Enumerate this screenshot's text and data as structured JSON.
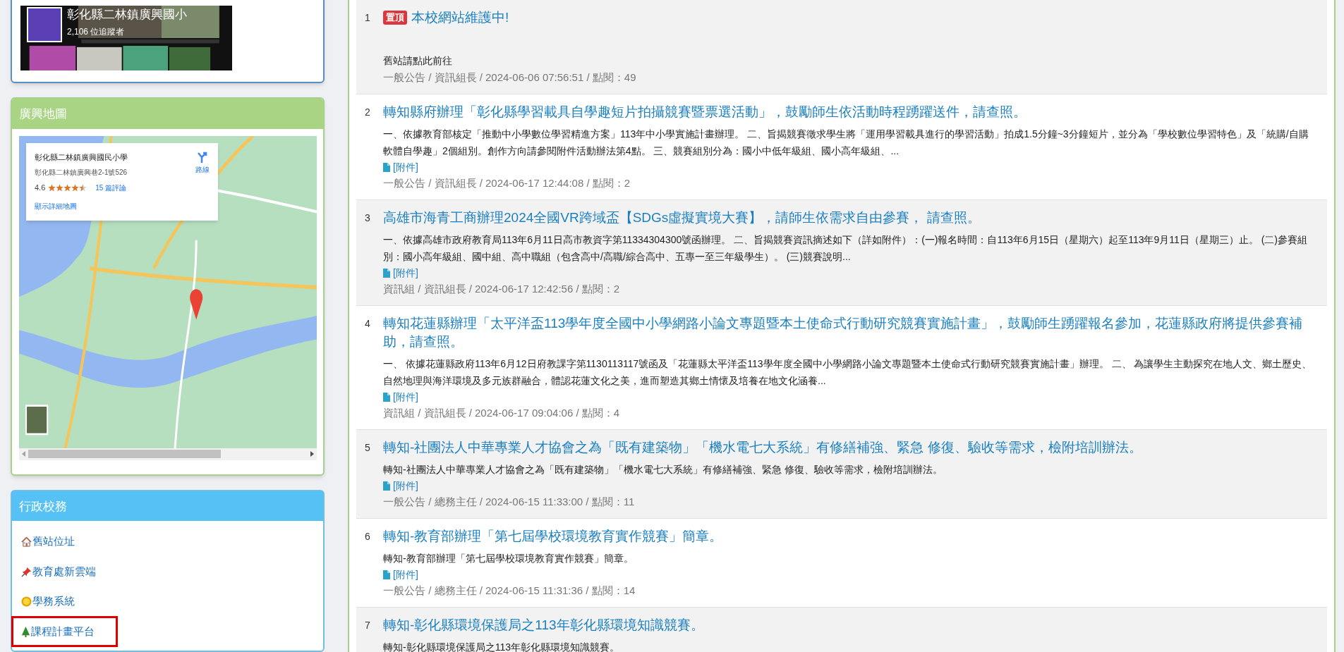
{
  "facebook_widget": {
    "page_name": "彰化縣二林鎮廣興國小",
    "followers": "2,106 位追蹤者"
  },
  "map_card": {
    "title": "廣興地圖",
    "place_name": "彰化縣二林鎮廣興國民小學",
    "address": "彰化縣二林鎮廣興巷2-1號526",
    "rating": "4.6",
    "stars": 4.5,
    "reviews": "15 篇評論",
    "directions": "路線",
    "larger_map": "顯示詳細地圖"
  },
  "admin_card": {
    "title": "行政校務",
    "items": [
      {
        "label": "舊站位址",
        "kind": "house",
        "highlighted": false
      },
      {
        "label": "教育處新雲端",
        "kind": "pin",
        "highlighted": false
      },
      {
        "label": "學務系統",
        "kind": "sun",
        "highlighted": false
      },
      {
        "label": "課程計畫平台",
        "kind": "tree",
        "highlighted": true
      }
    ]
  },
  "news": [
    {
      "number": "1",
      "badge": "置頂",
      "title": "本校網站維護中!",
      "summary": "舊站請點此前往",
      "meta": "一般公告 / 資訊組長 / 2024-06-06 07:56:51 / 點閱：49"
    },
    {
      "number": "2",
      "title": "轉知縣府辦理「彰化縣學習載具自學趣短片拍攝競賽暨票選活動」，鼓勵師生依活動時程踴躍送件，請查照。",
      "summary": "一、依據教育部核定「推動中小學數位學習精進方案」113年中小學實施計畫辦理。 二、旨揭競賽徵求學生將「運用學習載具進行的學習活動」拍成1.5分鐘~3分鐘短片，並分為「學校數位學習特色」及「統購/自購軟體自學趣」2個組別。創作方向請參閱附件活動辦法第4點。 三、競賽組別分為：國小中低年級組、國小高年級組、...",
      "attachment": "[附件]",
      "meta": "一般公告 / 資訊組長 / 2024-06-17 12:44:08 / 點閱：2"
    },
    {
      "number": "3",
      "title": "高雄市海青工商辦理2024全國VR跨域盃【SDGs虛擬實境大賽】，請師生依需求自由參賽， 請查照。",
      "summary": "一、依據高雄市政府教育局113年6月11日高市教資字第11334304300號函辦理。 二、旨揭競賽資訊摘述如下（詳如附件）：(一)報名時間：自113年6月15日（星期六）起至113年9月11日（星期三）止。 (二)參賽組別：國小高年級組、國中組、高中職組（包含高中/高職/綜合高中、五專一至三年級學生）。 (三)競賽說明...",
      "attachment": "[附件]",
      "meta": "資訊組 / 資訊組長 / 2024-06-17 12:42:56 / 點閱：2"
    },
    {
      "number": "4",
      "title": "轉知花蓮縣辦理「太平洋盃113學年度全國中小學網路小論文專題暨本土使命式行動研究競賽實施計畫」，鼓勵師生踴躍報名參加，花蓮縣政府將提供參賽補助，請查照。",
      "summary": "一、 依據花蓮縣政府113年6月12日府教課字第1130113117號函及「花蓮縣太平洋盃113學年度全國中小學網路小論文專題暨本土使命式行動研究競賽實施計畫」辦理。 二、 為讓學生主動探究在地人文、鄉土歷史、自然地理與海洋環境及多元族群融合，體認花蓮文化之美，進而塑造其鄉土情懷及培養在地文化涵養...",
      "attachment": "[附件]",
      "meta": "資訊組 / 資訊組長 / 2024-06-17 09:04:06 / 點閱：4"
    },
    {
      "number": "5",
      "title": "轉知-社團法人中華專業人才協會之為「既有建築物」「機水電七大系統」有修繕補強、緊急 修復、驗收等需求，檢附培訓辦法。",
      "summary": "轉知-社團法人中華專業人才協會之為「既有建築物」「機水電七大系統」有修繕補強、緊急 修復、驗收等需求，檢附培訓辦法。",
      "attachment": "[附件]",
      "meta": "一般公告 / 總務主任 / 2024-06-15 11:33:00 / 點閱：11"
    },
    {
      "number": "6",
      "title": "轉知-教育部辦理「第七屆學校環境教育實作競賽」簡章。",
      "summary": "轉知-教育部辦理「第七屆學校環境教育實作競賽」簡章。",
      "attachment": "[附件]",
      "meta": "一般公告 / 總務主任 / 2024-06-15 11:31:36 / 點閱：14"
    },
    {
      "number": "7",
      "title": "轉知-彰化縣環境保護局之113年彰化縣環境知識競賽。",
      "summary": "轉知-彰化縣環境保護局之113年彰化縣環境知識競賽。"
    }
  ]
}
